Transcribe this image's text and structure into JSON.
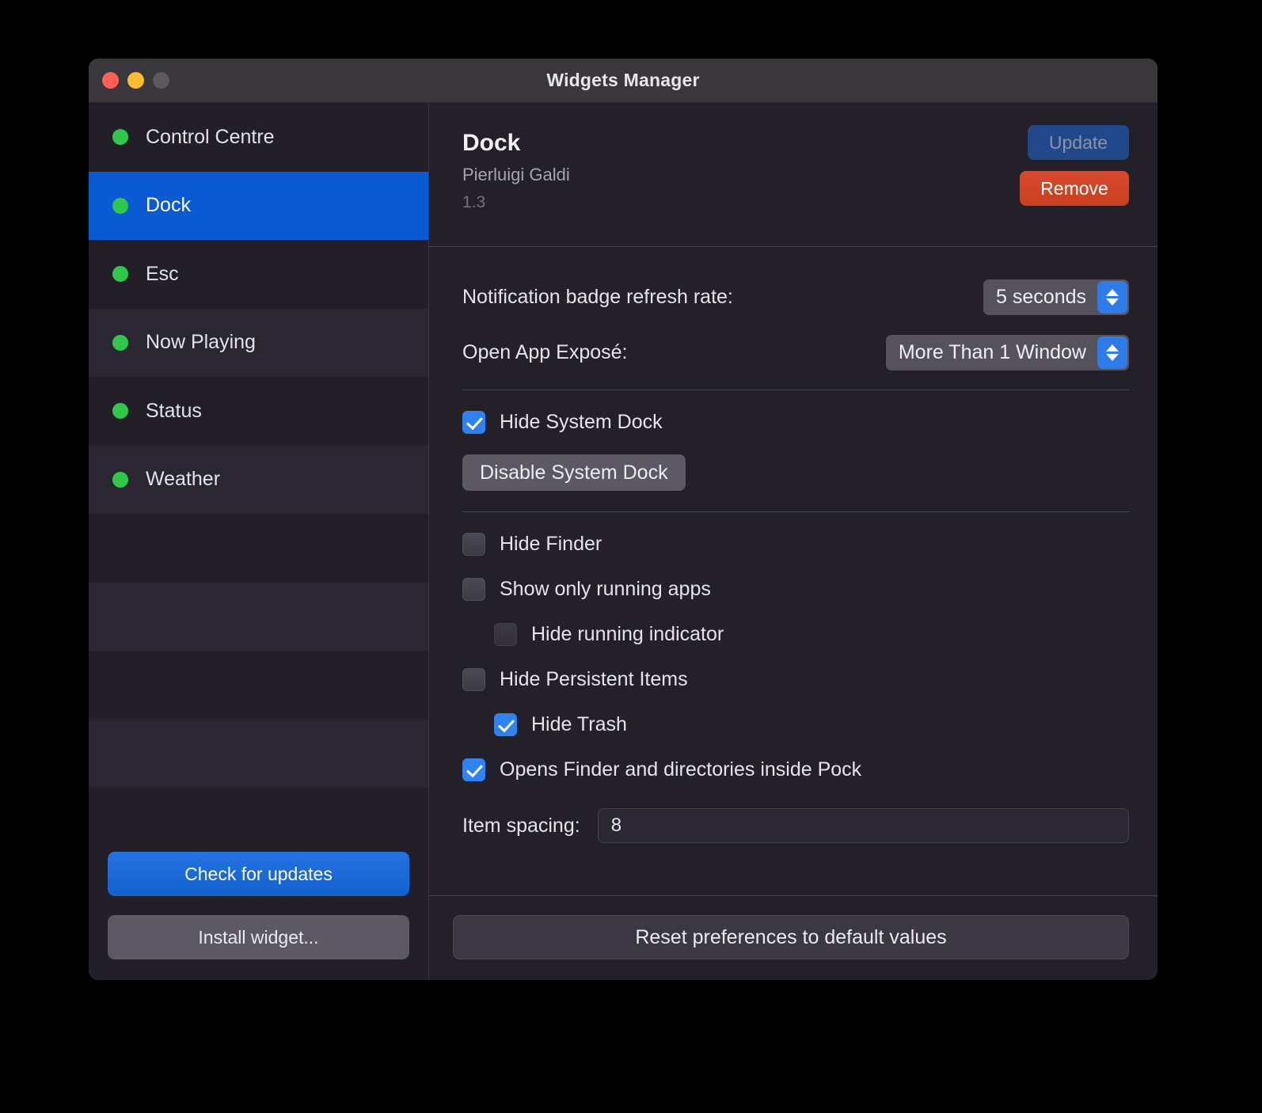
{
  "window": {
    "title": "Widgets Manager",
    "traffic_lights": [
      "close",
      "minimize",
      "zoom"
    ]
  },
  "sidebar": {
    "items": [
      {
        "label": "Control Centre",
        "status": "enabled",
        "selected": false
      },
      {
        "label": "Dock",
        "status": "enabled",
        "selected": true
      },
      {
        "label": "Esc",
        "status": "enabled",
        "selected": false
      },
      {
        "label": "Now Playing",
        "status": "enabled",
        "selected": false
      },
      {
        "label": "Status",
        "status": "enabled",
        "selected": false
      },
      {
        "label": "Weather",
        "status": "enabled",
        "selected": false
      }
    ],
    "empty_rows": 5,
    "check_updates_label": "Check for updates",
    "install_widget_label": "Install widget..."
  },
  "detail": {
    "widget_name": "Dock",
    "author": "Pierluigi Galdi",
    "version": "1.3",
    "update_label": "Update",
    "update_disabled": true,
    "remove_label": "Remove"
  },
  "settings": {
    "refresh_rate": {
      "label": "Notification badge refresh rate:",
      "value": "5 seconds"
    },
    "app_expose": {
      "label": "Open App Exposé:",
      "value": "More Than 1 Window"
    },
    "hide_system_dock": {
      "label": "Hide System Dock",
      "checked": true
    },
    "disable_system_dock_label": "Disable System Dock",
    "checkboxes": [
      {
        "label": "Hide Finder",
        "checked": false,
        "indent": false,
        "dim": false
      },
      {
        "label": "Show only running apps",
        "checked": false,
        "indent": false,
        "dim": false
      },
      {
        "label": "Hide running indicator",
        "checked": false,
        "indent": true,
        "dim": true
      },
      {
        "label": "Hide Persistent Items",
        "checked": false,
        "indent": false,
        "dim": false
      },
      {
        "label": "Hide Trash",
        "checked": true,
        "indent": true,
        "dim": false
      },
      {
        "label": "Opens Finder and directories inside Pock",
        "checked": true,
        "indent": false,
        "dim": false
      }
    ],
    "item_spacing": {
      "label": "Item spacing:",
      "value": "8"
    },
    "reset_label": "Reset preferences to default values"
  },
  "colors": {
    "accent_blue": "#0a5bd3",
    "status_green": "#2fc84b",
    "remove_red": "#d9492f",
    "window_bg": "#242029",
    "sidebar_bg": "#221f28",
    "titlebar_bg": "#39363c"
  }
}
